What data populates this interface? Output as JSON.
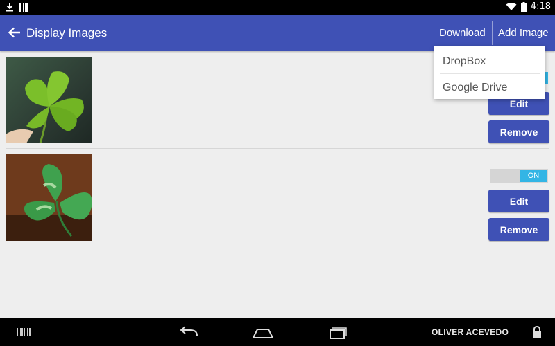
{
  "status_bar": {
    "time": "4:18"
  },
  "app_bar": {
    "title": "Display Images",
    "actions": {
      "download": "Download",
      "add_image": "Add Image"
    }
  },
  "dropdown": {
    "items": [
      {
        "label": "DropBox"
      },
      {
        "label": "Google Drive"
      }
    ]
  },
  "rows": [
    {
      "edit_label": "Edit",
      "remove_label": "Remove"
    },
    {
      "toggle_label": "ON",
      "edit_label": "Edit",
      "remove_label": "Remove"
    }
  ],
  "nav_bar": {
    "user": "OLIVER ACEVEDO"
  },
  "colors": {
    "primary": "#3f51b5",
    "toggle_on": "#33b5e5"
  }
}
